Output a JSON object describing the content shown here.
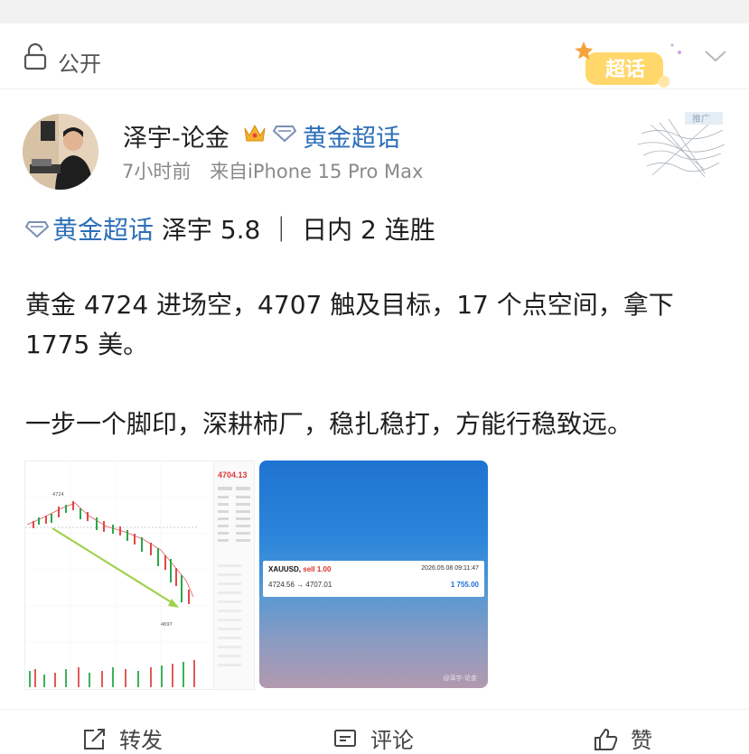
{
  "visibility": {
    "label": "公开"
  },
  "badge": {
    "label": "超话"
  },
  "author": {
    "name": "泽宇-论金",
    "supertopic": "黄金超话",
    "time": "7小时前",
    "source": "来自iPhone 15 Pro Max"
  },
  "post": {
    "topic": "黄金超话",
    "topic_rest": " 泽宇 5.8 ｜ 日内 2 连胜",
    "para1": "黄金 4724 进场空，4707 触及目标，17 个点空间，拿下 1775 美。",
    "para2": "一步一个脚印，深耕柿厂，稳扎稳打，方能行稳致远。"
  },
  "images": {
    "chart": {
      "price": "4704.13",
      "high_label": "4724",
      "low_label": "4697"
    },
    "trade": {
      "symbol": "XAUUSD,",
      "side": "sell 1.00",
      "date": "2026.05.08 09:11:47",
      "prices": "4724.56 → 4707.01",
      "profit": "1 755.00",
      "watermark": "@泽宇-论金"
    }
  },
  "actions": {
    "repost": "转发",
    "comment": "评论",
    "like": "赞"
  }
}
